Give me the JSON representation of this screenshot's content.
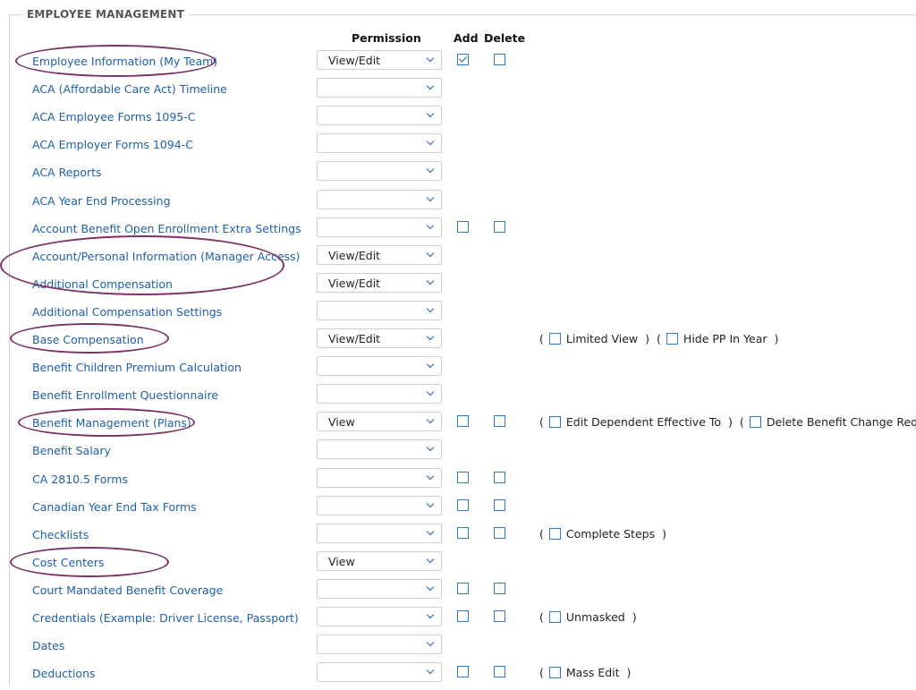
{
  "section": {
    "title": "EMPLOYEE MANAGEMENT"
  },
  "columns": {
    "permission": "Permission",
    "add": "Add",
    "delete": "Delete"
  },
  "rows": [
    {
      "label": "Employee Information (My Team)",
      "permission": "View/Edit",
      "add": true,
      "add_checked": true,
      "del": true,
      "extras": []
    },
    {
      "label": "ACA (Affordable Care Act) Timeline",
      "permission": "",
      "add": false,
      "del": false,
      "extras": []
    },
    {
      "label": "ACA Employee Forms 1095-C",
      "permission": "",
      "add": false,
      "del": false,
      "extras": []
    },
    {
      "label": "ACA Employer Forms 1094-C",
      "permission": "",
      "add": false,
      "del": false,
      "extras": []
    },
    {
      "label": "ACA Reports",
      "permission": "",
      "add": false,
      "del": false,
      "extras": []
    },
    {
      "label": "ACA Year End Processing",
      "permission": "",
      "add": false,
      "del": false,
      "extras": []
    },
    {
      "label": "Account Benefit Open Enrollment Extra Settings",
      "permission": "",
      "add": true,
      "del": true,
      "extras": []
    },
    {
      "label": "Account/Personal Information (Manager Access)",
      "permission": "View/Edit",
      "add": false,
      "del": false,
      "extras": []
    },
    {
      "label": "Additional Compensation",
      "permission": "View/Edit",
      "add": false,
      "del": false,
      "extras": []
    },
    {
      "label": "Additional Compensation Settings",
      "permission": "",
      "add": false,
      "del": false,
      "extras": []
    },
    {
      "label": "Base Compensation",
      "permission": "View/Edit",
      "add": false,
      "del": false,
      "extras": [
        "Limited View",
        "Hide PP In Year"
      ]
    },
    {
      "label": "Benefit Children Premium Calculation",
      "permission": "",
      "add": false,
      "del": false,
      "extras": []
    },
    {
      "label": "Benefit Enrollment Questionnaire",
      "permission": "",
      "add": false,
      "del": false,
      "extras": []
    },
    {
      "label": "Benefit Management (Plans)",
      "permission": "View",
      "add": true,
      "del": true,
      "extras": [
        "Edit Dependent Effective To",
        "Delete Benefit Change Request"
      ]
    },
    {
      "label": "Benefit Salary",
      "permission": "",
      "add": false,
      "del": false,
      "extras": []
    },
    {
      "label": "CA 2810.5 Forms",
      "permission": "",
      "add": true,
      "del": true,
      "extras": []
    },
    {
      "label": "Canadian Year End Tax Forms",
      "permission": "",
      "add": true,
      "del": true,
      "extras": []
    },
    {
      "label": "Checklists",
      "permission": "",
      "add": true,
      "del": true,
      "extras": [
        "Complete Steps"
      ]
    },
    {
      "label": "Cost Centers",
      "permission": "View",
      "add": false,
      "del": false,
      "extras": []
    },
    {
      "label": "Court Mandated Benefit Coverage",
      "permission": "",
      "add": true,
      "del": true,
      "extras": []
    },
    {
      "label": "Credentials (Example: Driver License, Passport)",
      "permission": "",
      "add": true,
      "del": true,
      "extras": [
        "Unmasked"
      ]
    },
    {
      "label": "Dates",
      "permission": "",
      "add": false,
      "del": false,
      "extras": []
    },
    {
      "label": "Deductions",
      "permission": "",
      "add": true,
      "del": true,
      "extras": [
        "Mass Edit"
      ]
    }
  ],
  "colors": {
    "link": "#1f5fa8",
    "checkbox": "#2a79c8",
    "annotation": "#7a3365"
  }
}
